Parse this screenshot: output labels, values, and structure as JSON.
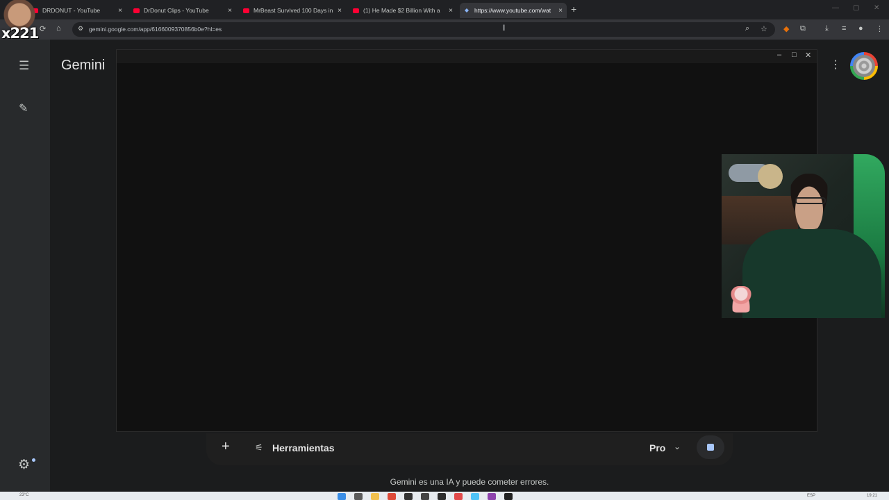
{
  "browser": {
    "tabs": [
      {
        "label": "DRDONUT - YouTube",
        "active": false
      },
      {
        "label": "DrDonut Clips - YouTube",
        "active": false
      },
      {
        "label": "MrBeast Survived 100 Days in ",
        "active": false
      },
      {
        "label": "(1) He Made $2 Billion With a ",
        "active": false
      },
      {
        "label": "https://www.youtube.com/wat",
        "active": true
      }
    ],
    "tab_close_glyph": "×",
    "new_tab_glyph": "+",
    "address": "gemini.google.com/app/6166009370856b0e?hl=es"
  },
  "overlay": {
    "streamer_tag": "x221"
  },
  "gemini": {
    "brand": "Gemini",
    "input": {
      "plus_glyph": "+",
      "tools_label": "Herramientas",
      "model_label": "Pro"
    },
    "disclaimer": "Gemini es una IA y puede cometer errores."
  },
  "taskbar": {
    "weather": "23°C",
    "language": "ESP",
    "time": "19:21"
  },
  "colors": {
    "app_bg": "#1b1c1d",
    "rail_bg": "#282a2c",
    "accent": "#a8c7fa",
    "youtube_red": "#ff0033"
  }
}
